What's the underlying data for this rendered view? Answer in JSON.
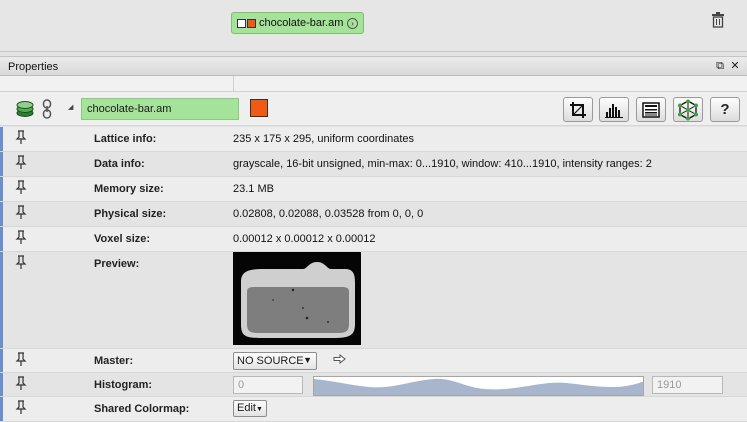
{
  "pool": {
    "node_label": "chocolate-bar.am",
    "node_color": "#a6e39a",
    "swatch_color": "#f05a14",
    "icons": [
      "white-square-icon",
      "orange-square-icon",
      "circle-arrow-icon",
      "trash-icon"
    ]
  },
  "panel": {
    "title": "Properties",
    "float_icon": "⧉",
    "close_icon": "✕"
  },
  "object": {
    "name": "chocolate-bar.am",
    "expander": "◢",
    "help_label": "?",
    "tools": [
      "crop-icon",
      "histogram-icon",
      "data-view-icon",
      "graph-network-icon",
      "help-icon"
    ]
  },
  "properties": {
    "lattice": {
      "label": "Lattice info:",
      "value": "235 x 175 x 295, uniform coordinates"
    },
    "data": {
      "label": "Data info:",
      "value": "grayscale, 16-bit unsigned, min-max: 0...1910, window: 410...1910, intensity ranges: 2"
    },
    "memory": {
      "label": "Memory size:",
      "value": "23.1 MB"
    },
    "physical": {
      "label": "Physical size:",
      "value": "0.02808, 0.02088, 0.03528  from 0, 0, 0"
    },
    "voxel": {
      "label": "Voxel size:",
      "value": "0.00012 x 0.00012 x 0.00012"
    },
    "preview": {
      "label": "Preview:"
    },
    "master": {
      "label": "Master:",
      "value": "NO SOURCE",
      "caret": "▼"
    },
    "histogram": {
      "label": "Histogram:",
      "min": "0",
      "max": "1910"
    },
    "colormap": {
      "label": "Shared Colormap:",
      "button": "Edit",
      "caret": "▼"
    }
  }
}
